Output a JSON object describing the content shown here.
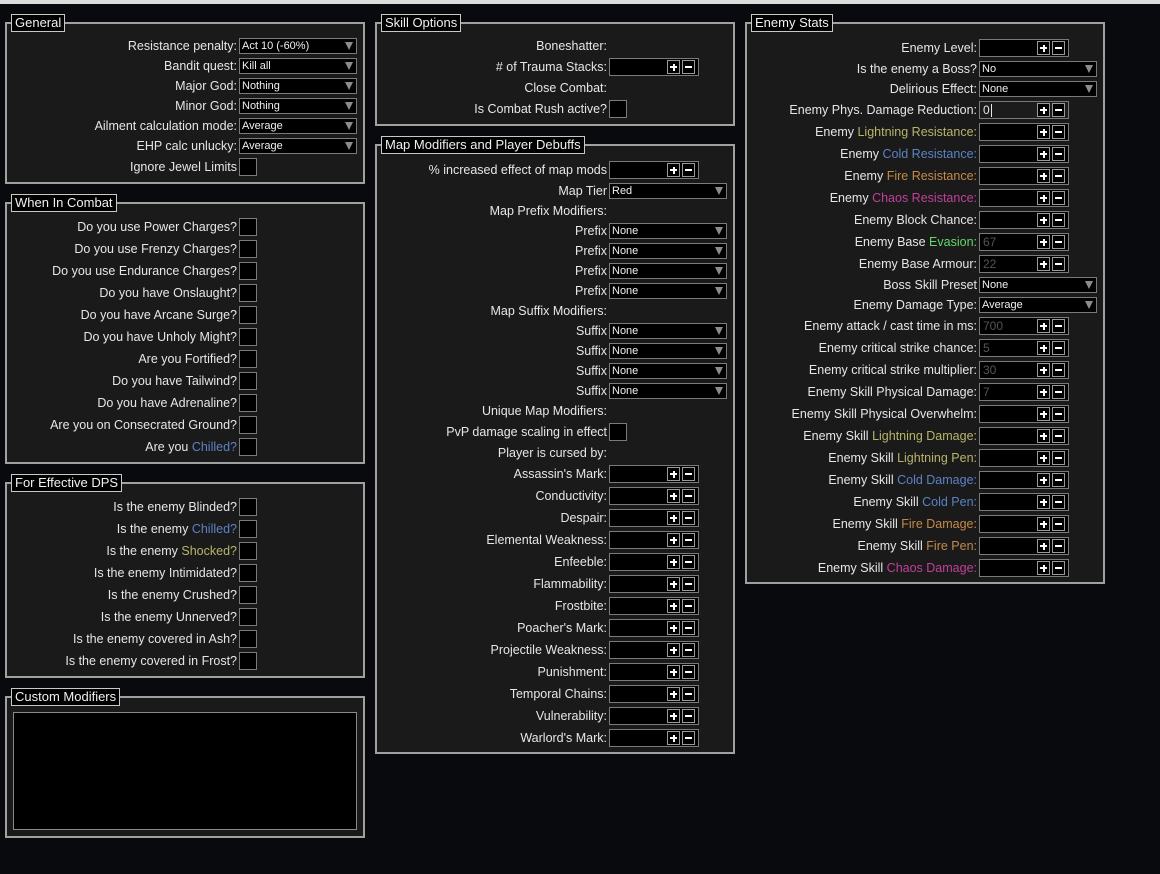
{
  "colors": {
    "cold": "#5b82c4",
    "lightning": "#b8b46a",
    "fire": "#c4894a",
    "chaos": "#c0409a",
    "evasion": "#66d666"
  },
  "general": {
    "title": "General",
    "rows": [
      {
        "label": "Resistance penalty:",
        "type": "dropdown",
        "value": "Act 10 (-60%)"
      },
      {
        "label": "Bandit quest:",
        "type": "dropdown",
        "value": "Kill all"
      },
      {
        "label": "Major God:",
        "type": "dropdown",
        "value": "Nothing"
      },
      {
        "label": "Minor God:",
        "type": "dropdown",
        "value": "Nothing"
      },
      {
        "label": "Ailment calculation mode:",
        "type": "dropdown",
        "value": "Average"
      },
      {
        "label": "EHP calc unlucky:",
        "type": "dropdown",
        "value": "Average"
      },
      {
        "label": "Ignore Jewel Limits",
        "type": "checkbox",
        "checked": false
      }
    ]
  },
  "combat": {
    "title": "When In Combat",
    "rows": [
      {
        "label": "Do you use Power Charges?"
      },
      {
        "label": "Do you use Frenzy Charges?"
      },
      {
        "label": "Do you use Endurance Charges?"
      },
      {
        "label": "Do you have Onslaught?"
      },
      {
        "label": "Do you have Arcane Surge?"
      },
      {
        "label": "Do you have Unholy Might?"
      },
      {
        "label": "Are you Fortified?"
      },
      {
        "label": "Do you have Tailwind?"
      },
      {
        "label": "Do you have Adrenaline?"
      },
      {
        "label": "Are you on Consecrated Ground?"
      },
      {
        "label": "Are you ",
        "accent": "Chilled?",
        "accent_class": "c-cold"
      }
    ]
  },
  "dps": {
    "title": "For Effective DPS",
    "rows": [
      {
        "label": "Is the enemy Blinded?"
      },
      {
        "label": "Is the enemy ",
        "accent": "Chilled?",
        "accent_class": "c-cold"
      },
      {
        "label": "Is the enemy ",
        "accent": "Shocked?",
        "accent_class": "c-light"
      },
      {
        "label": "Is the enemy Intimidated?"
      },
      {
        "label": "Is the enemy Crushed?"
      },
      {
        "label": "Is the enemy Unnerved?"
      },
      {
        "label": "Is the enemy covered in Ash?"
      },
      {
        "label": "Is the enemy covered in Frost?"
      }
    ]
  },
  "custom": {
    "title": "Custom Modifiers",
    "value": ""
  },
  "skill": {
    "title": "Skill Options",
    "rows": [
      {
        "label": "Boneshatter:",
        "type": "header"
      },
      {
        "label": "# of Trauma Stacks:",
        "type": "number",
        "value": ""
      },
      {
        "label": "Close Combat:",
        "type": "header"
      },
      {
        "label": "Is Combat Rush active?",
        "type": "checkbox"
      }
    ]
  },
  "map": {
    "title": "Map Modifiers and Player Debuffs",
    "rows": [
      {
        "label": "% increased effect of map mods",
        "type": "number",
        "value": ""
      },
      {
        "label": "Map Tier",
        "type": "dropdown",
        "value": "Red"
      },
      {
        "label": "Map Prefix Modifiers:",
        "type": "header"
      },
      {
        "label": "Prefix",
        "type": "dropdown",
        "value": "None"
      },
      {
        "label": "Prefix",
        "type": "dropdown",
        "value": "None"
      },
      {
        "label": "Prefix",
        "type": "dropdown",
        "value": "None"
      },
      {
        "label": "Prefix",
        "type": "dropdown",
        "value": "None"
      },
      {
        "label": "Map Suffix Modifiers:",
        "type": "header"
      },
      {
        "label": "Suffix",
        "type": "dropdown",
        "value": "None"
      },
      {
        "label": "Suffix",
        "type": "dropdown",
        "value": "None"
      },
      {
        "label": "Suffix",
        "type": "dropdown",
        "value": "None"
      },
      {
        "label": "Suffix",
        "type": "dropdown",
        "value": "None"
      },
      {
        "label": "Unique Map Modifiers:",
        "type": "header"
      },
      {
        "label": "PvP damage scaling in effect",
        "type": "checkbox"
      },
      {
        "label": "Player is cursed by:",
        "type": "header"
      },
      {
        "label": "Assassin's Mark:",
        "type": "number",
        "value": ""
      },
      {
        "label": "Conductivity:",
        "type": "number",
        "value": ""
      },
      {
        "label": "Despair:",
        "type": "number",
        "value": ""
      },
      {
        "label": "Elemental Weakness:",
        "type": "number",
        "value": ""
      },
      {
        "label": "Enfeeble:",
        "type": "number",
        "value": ""
      },
      {
        "label": "Flammability:",
        "type": "number",
        "value": ""
      },
      {
        "label": "Frostbite:",
        "type": "number",
        "value": ""
      },
      {
        "label": "Poacher's Mark:",
        "type": "number",
        "value": ""
      },
      {
        "label": "Projectile Weakness:",
        "type": "number",
        "value": ""
      },
      {
        "label": "Punishment:",
        "type": "number",
        "value": ""
      },
      {
        "label": "Temporal Chains:",
        "type": "number",
        "value": ""
      },
      {
        "label": "Vulnerability:",
        "type": "number",
        "value": ""
      },
      {
        "label": "Warlord's Mark:",
        "type": "number",
        "value": ""
      }
    ]
  },
  "enemy": {
    "title": "Enemy Stats",
    "rows": [
      {
        "label": "Enemy Level:",
        "type": "number",
        "value": ""
      },
      {
        "label": "Is the enemy a Boss?",
        "type": "dropdown",
        "value": "No"
      },
      {
        "label": "Delirious Effect:",
        "type": "dropdown",
        "value": "None"
      },
      {
        "label": "Enemy Phys. Damage Reduction:",
        "type": "number",
        "value": "0",
        "focused": true
      },
      {
        "label": "Enemy ",
        "accent": "Lightning Resistance:",
        "accent_class": "c-light",
        "type": "number",
        "value": ""
      },
      {
        "label": "Enemy ",
        "accent": "Cold Resistance:",
        "accent_class": "c-cold",
        "type": "number",
        "value": ""
      },
      {
        "label": "Enemy ",
        "accent": "Fire Resistance:",
        "accent_class": "c-fire",
        "type": "number",
        "value": ""
      },
      {
        "label": "Enemy ",
        "accent": "Chaos Resistance:",
        "accent_class": "c-chaos",
        "type": "number",
        "value": ""
      },
      {
        "label": "Enemy Block Chance:",
        "type": "number",
        "value": ""
      },
      {
        "label": "Enemy Base ",
        "accent": "Evasion:",
        "accent_class": "c-eva",
        "type": "number",
        "value": "67"
      },
      {
        "label": "Enemy Base Armour:",
        "type": "number",
        "value": "22"
      },
      {
        "label": "Boss Skill Preset",
        "type": "dropdown",
        "value": "None"
      },
      {
        "label": "Enemy Damage Type:",
        "type": "dropdown",
        "value": "Average"
      },
      {
        "label": "Enemy attack / cast time in ms:",
        "type": "number",
        "value": "700"
      },
      {
        "label": "Enemy critical strike chance:",
        "type": "number",
        "value": "5"
      },
      {
        "label": "Enemy critical strike multiplier:",
        "type": "number",
        "value": "30"
      },
      {
        "label": "Enemy Skill Physical Damage:",
        "type": "number",
        "value": "7"
      },
      {
        "label": "Enemy Skill Physical Overwhelm:",
        "type": "number",
        "value": ""
      },
      {
        "label": "Enemy Skill ",
        "accent": "Lightning Damage:",
        "accent_class": "c-light",
        "type": "number",
        "value": ""
      },
      {
        "label": "Enemy Skill ",
        "accent": "Lightning Pen:",
        "accent_class": "c-light",
        "type": "number",
        "value": ""
      },
      {
        "label": "Enemy Skill ",
        "accent": "Cold Damage:",
        "accent_class": "c-cold",
        "type": "number",
        "value": ""
      },
      {
        "label": "Enemy Skill ",
        "accent": "Cold Pen:",
        "accent_class": "c-cold",
        "type": "number",
        "value": ""
      },
      {
        "label": "Enemy Skill ",
        "accent": "Fire Damage:",
        "accent_class": "c-fire",
        "type": "number",
        "value": ""
      },
      {
        "label": "Enemy Skill ",
        "accent": "Fire Pen:",
        "accent_class": "c-fire",
        "type": "number",
        "value": ""
      },
      {
        "label": "Enemy Skill ",
        "accent": "Chaos Damage:",
        "accent_class": "c-chaos",
        "type": "number",
        "value": ""
      }
    ]
  }
}
